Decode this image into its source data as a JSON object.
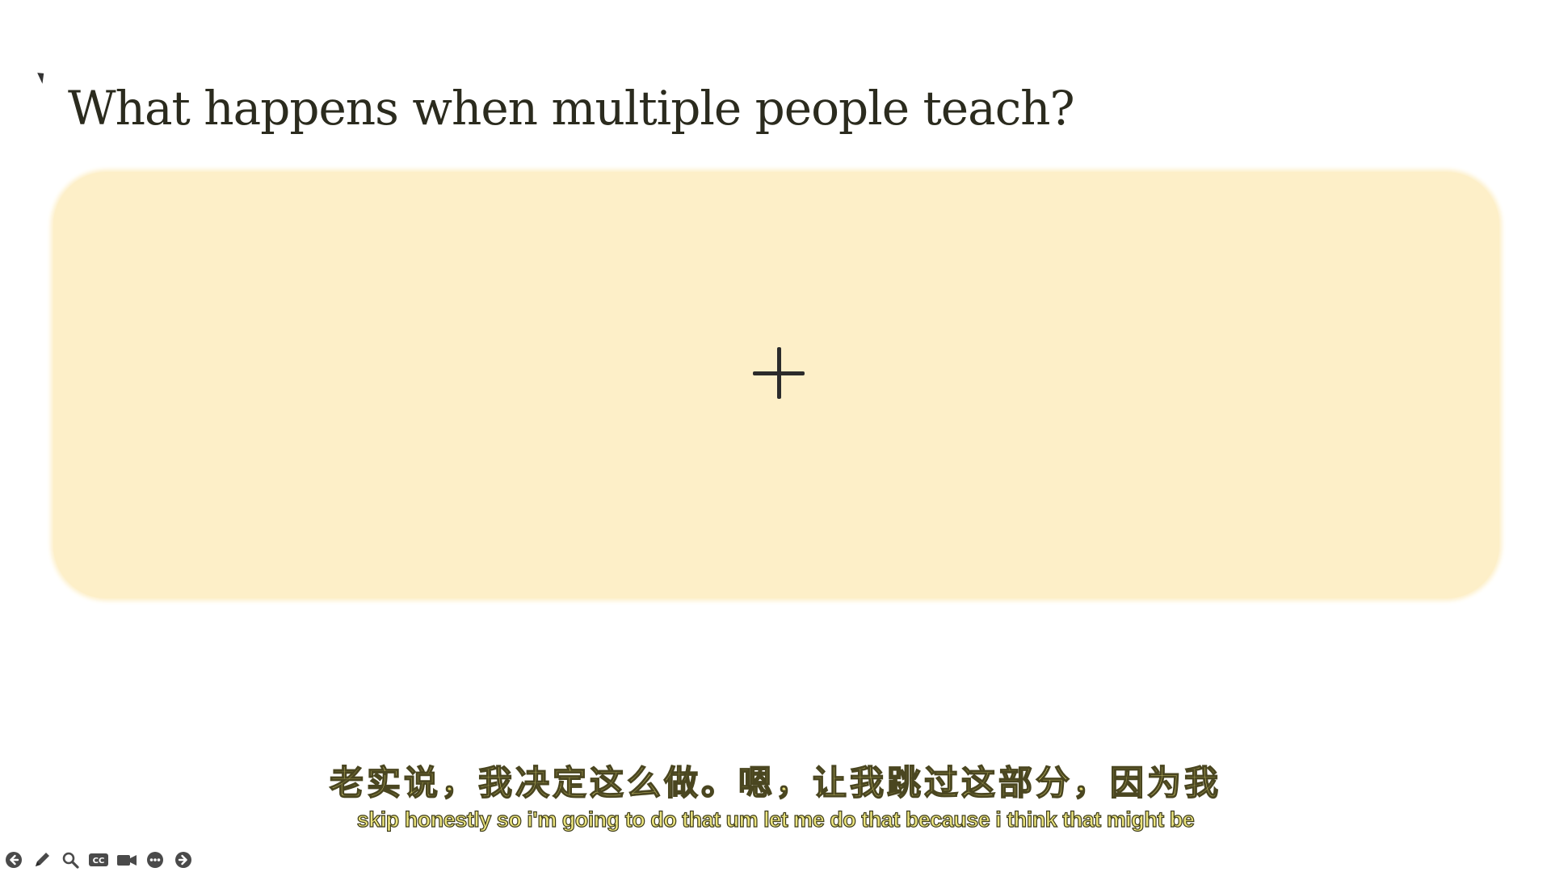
{
  "slide": {
    "title": "What happens when multiple people teach?",
    "card_color": "#fdefc8",
    "card_icon": "plus-icon"
  },
  "subtitles": {
    "chinese": "老实说，我决定这么做。嗯，让我跳过这部分，因为我",
    "english": "skip honestly so i'm going to do that um let me do that because i think that might be",
    "fill_color": "#e8df7a"
  },
  "toolbar": {
    "buttons": [
      {
        "icon": "previous-slide-icon"
      },
      {
        "icon": "pen-icon"
      },
      {
        "icon": "zoom-icon"
      },
      {
        "icon": "closed-captions-icon"
      },
      {
        "icon": "camera-icon"
      },
      {
        "icon": "more-options-icon"
      },
      {
        "icon": "next-slide-icon"
      }
    ],
    "cc_label": "CC"
  }
}
